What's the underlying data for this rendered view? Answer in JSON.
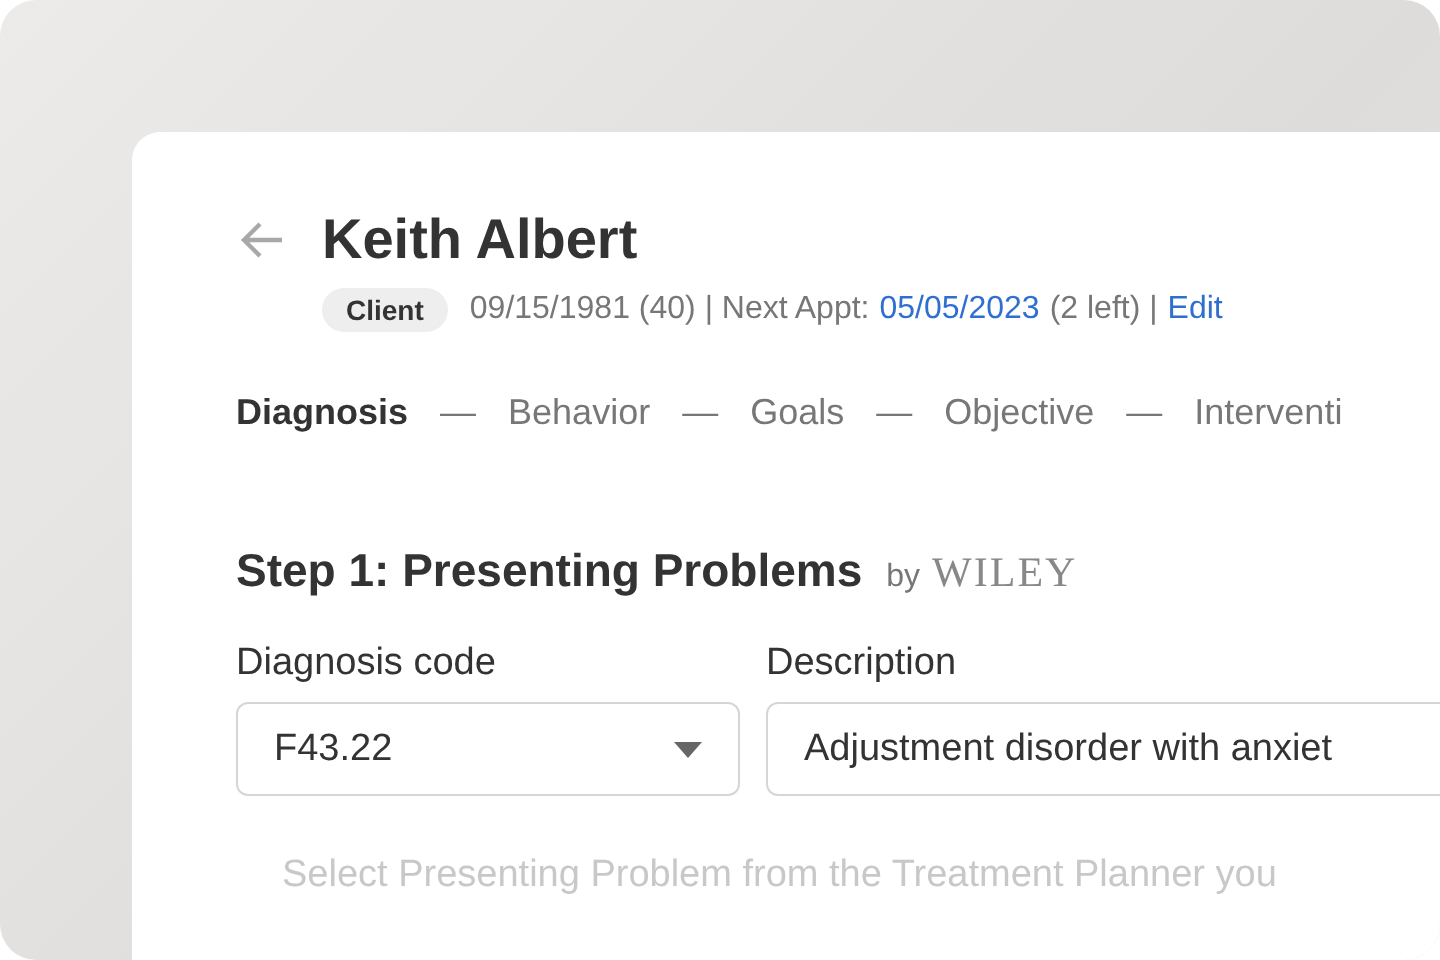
{
  "header": {
    "name": "Keith Albert",
    "badge": "Client",
    "dob": "09/15/1981 (40) | Next Appt:",
    "appt_date": "05/05/2023",
    "appt_rest": "(2 left) |",
    "edit_link": "Edit"
  },
  "steps": [
    {
      "kind": "step",
      "label": "Diagnosis",
      "selected": true
    },
    {
      "kind": "separator",
      "label": "—"
    },
    {
      "kind": "step",
      "label": "Behavior",
      "selected": false
    },
    {
      "kind": "separator",
      "label": "—"
    },
    {
      "kind": "step",
      "label": "Goals",
      "selected": false
    },
    {
      "kind": "separator",
      "label": "—"
    },
    {
      "kind": "step",
      "label": "Objective",
      "selected": false
    },
    {
      "kind": "separator",
      "label": "—"
    },
    {
      "kind": "step",
      "label": "Interventi",
      "selected": false
    }
  ],
  "section": {
    "title": "Step 1: Presenting Problems",
    "by": "by",
    "brand": "WILEY"
  },
  "fields": [
    {
      "label": "Diagnosis code",
      "kind": "dropdown",
      "value": "F43.22"
    },
    {
      "label": "Description",
      "kind": "text",
      "value": "Adjustment disorder with anxiet"
    }
  ],
  "hint": "Select Presenting Problem from the Treatment Planner you"
}
